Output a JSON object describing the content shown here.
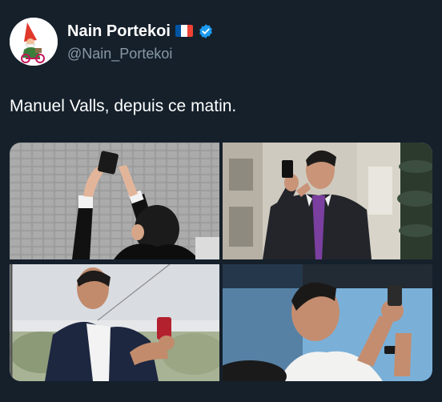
{
  "user": {
    "display_name": "Nain Portekoi",
    "handle": "@Nain_Portekoi",
    "avatar_icon": "garden-gnome-avatar",
    "flag_icon": "france-flag-icon",
    "verified_icon": "verified-badge-icon"
  },
  "tweet": {
    "text": "Manuel Valls, depuis ce matin."
  },
  "media": {
    "photo_count": 4,
    "photos": [
      {
        "subject": "man-from-behind-raising-phone"
      },
      {
        "subject": "man-in-suit-photographing"
      },
      {
        "subject": "man-with-red-phone"
      },
      {
        "subject": "man-photographing-stage"
      }
    ]
  },
  "colors": {
    "background": "#15202b",
    "text_primary": "#ffffff",
    "text_secondary": "#8899a6",
    "verified_blue": "#1d9bf0",
    "flag_blue": "#0055a4",
    "flag_red": "#ef4135"
  }
}
